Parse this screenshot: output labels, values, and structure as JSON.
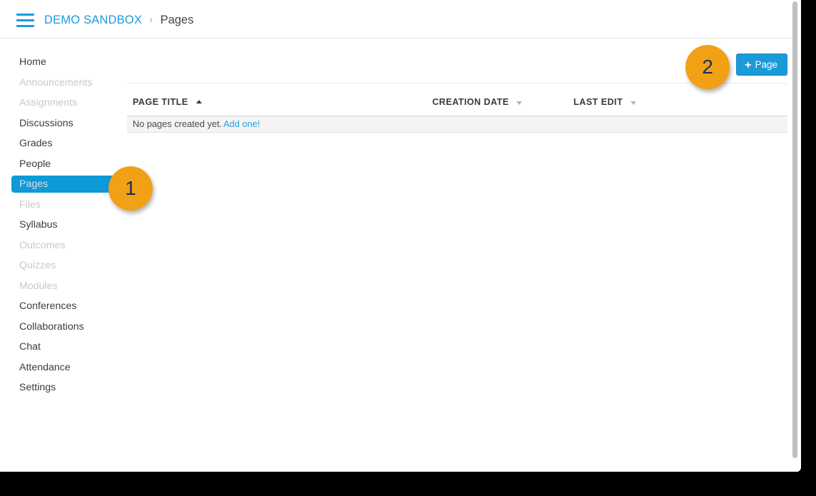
{
  "header": {
    "menu_icon": "hamburger-icon",
    "breadcrumb": {
      "course": "DEMO SANDBOX",
      "separator": "›",
      "current": "Pages"
    }
  },
  "sidebar": {
    "items": [
      {
        "label": "Home",
        "state": "normal"
      },
      {
        "label": "Announcements",
        "state": "disabled"
      },
      {
        "label": "Assignments",
        "state": "disabled"
      },
      {
        "label": "Discussions",
        "state": "normal"
      },
      {
        "label": "Grades",
        "state": "normal"
      },
      {
        "label": "People",
        "state": "normal"
      },
      {
        "label": "Pages",
        "state": "active"
      },
      {
        "label": "Files",
        "state": "disabled"
      },
      {
        "label": "Syllabus",
        "state": "normal"
      },
      {
        "label": "Outcomes",
        "state": "disabled"
      },
      {
        "label": "Quizzes",
        "state": "disabled"
      },
      {
        "label": "Modules",
        "state": "disabled"
      },
      {
        "label": "Conferences",
        "state": "normal"
      },
      {
        "label": "Collaborations",
        "state": "normal"
      },
      {
        "label": "Chat",
        "state": "normal"
      },
      {
        "label": "Attendance",
        "state": "normal"
      },
      {
        "label": "Settings",
        "state": "normal"
      }
    ]
  },
  "toolbar": {
    "add_page_plus": "+",
    "add_page_label": "Page"
  },
  "table": {
    "columns": {
      "page_title": "PAGE TITLE",
      "creation_date": "CREATION DATE",
      "last_edit": "LAST EDIT"
    },
    "sort": {
      "page_title": "ascending",
      "creation_date": "none",
      "last_edit": "none"
    },
    "empty_state": {
      "message": "No pages created yet.",
      "link_label": "Add one!"
    },
    "rows": []
  },
  "callouts": [
    {
      "number": "1",
      "target": "sidebar-item-pages"
    },
    {
      "number": "2",
      "target": "add-page-button"
    }
  ],
  "colors": {
    "accent_blue": "#1a9ae0",
    "active_nav_blue": "#0d9ad8",
    "button_blue": "#1b9ad8",
    "callout_orange": "#f2a014",
    "callout_number": "#13315c",
    "disabled_text": "#c8c8c8",
    "row_background": "#f4f4f4"
  }
}
